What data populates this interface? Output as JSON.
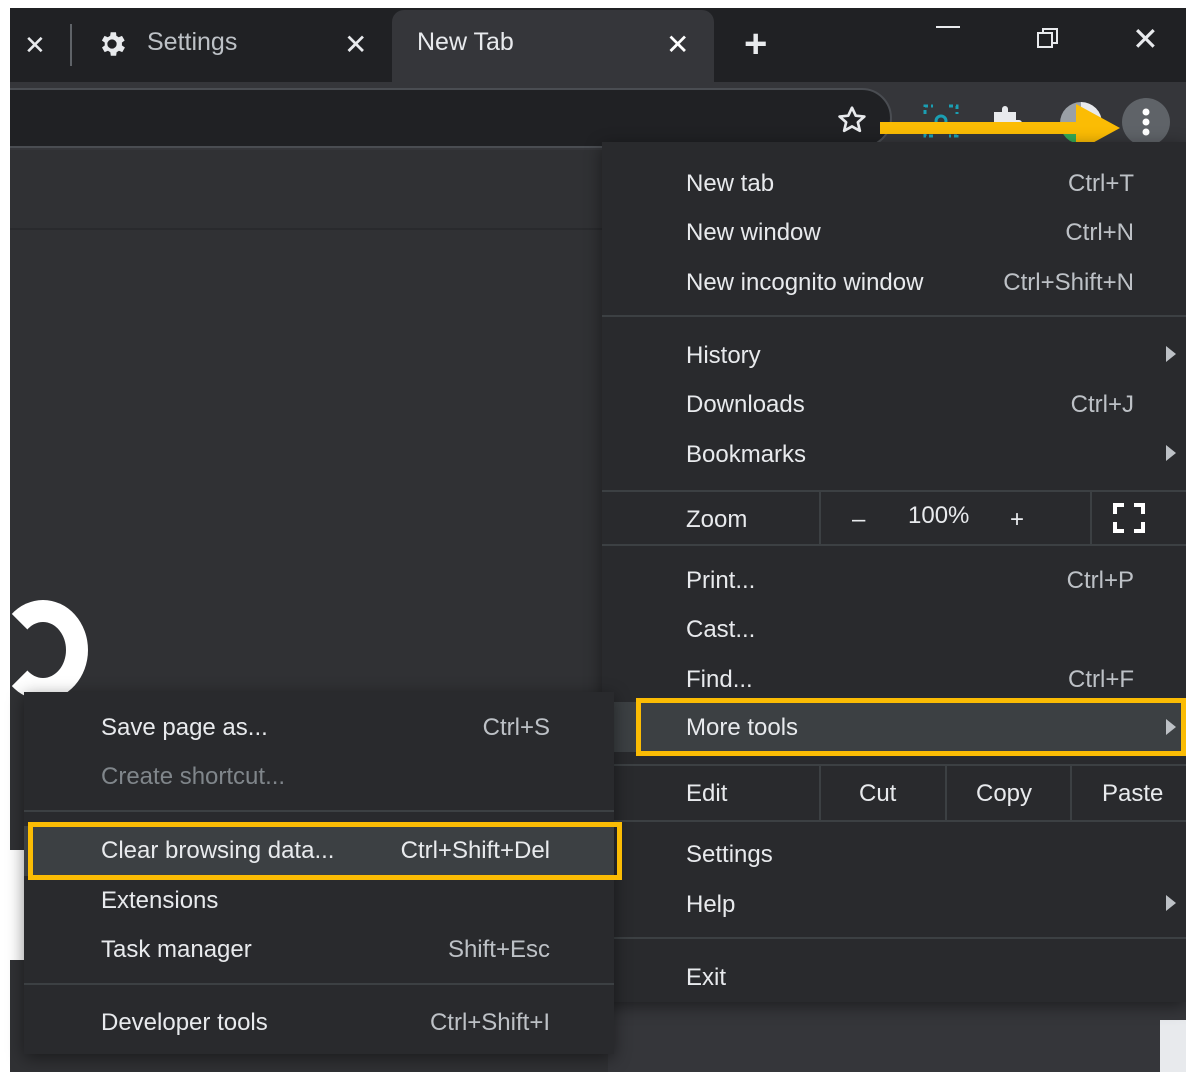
{
  "tabs": [
    {
      "label": "Settings",
      "icon": "gear-icon"
    },
    {
      "label": "New Tab",
      "active": true
    }
  ],
  "colors": {
    "highlight": "#fbbc04",
    "menu_bg": "#292a2d",
    "frame_bg": "#202124"
  },
  "main_menu": {
    "new_tab": {
      "label": "New tab",
      "shortcut": "Ctrl+T"
    },
    "new_window": {
      "label": "New window",
      "shortcut": "Ctrl+N"
    },
    "incognito": {
      "label": "New incognito window",
      "shortcut": "Ctrl+Shift+N"
    },
    "history": {
      "label": "History"
    },
    "downloads": {
      "label": "Downloads",
      "shortcut": "Ctrl+J"
    },
    "bookmarks": {
      "label": "Bookmarks"
    },
    "zoom": {
      "label": "Zoom",
      "minus": "–",
      "level": "100%",
      "plus": "+"
    },
    "print": {
      "label": "Print...",
      "shortcut": "Ctrl+P"
    },
    "cast": {
      "label": "Cast..."
    },
    "find": {
      "label": "Find...",
      "shortcut": "Ctrl+F"
    },
    "more_tools": {
      "label": "More tools"
    },
    "edit": {
      "label": "Edit",
      "cut": "Cut",
      "copy": "Copy",
      "paste": "Paste"
    },
    "settings": {
      "label": "Settings"
    },
    "help": {
      "label": "Help"
    },
    "exit": {
      "label": "Exit"
    }
  },
  "sub_menu": {
    "save_page": {
      "label": "Save page as...",
      "shortcut": "Ctrl+S"
    },
    "create_shortcut": {
      "label": "Create shortcut..."
    },
    "clear_browsing": {
      "label": "Clear browsing data...",
      "shortcut": "Ctrl+Shift+Del"
    },
    "extensions": {
      "label": "Extensions"
    },
    "task_manager": {
      "label": "Task manager",
      "shortcut": "Shift+Esc"
    },
    "developer_tools": {
      "label": "Developer tools",
      "shortcut": "Ctrl+Shift+I"
    }
  }
}
